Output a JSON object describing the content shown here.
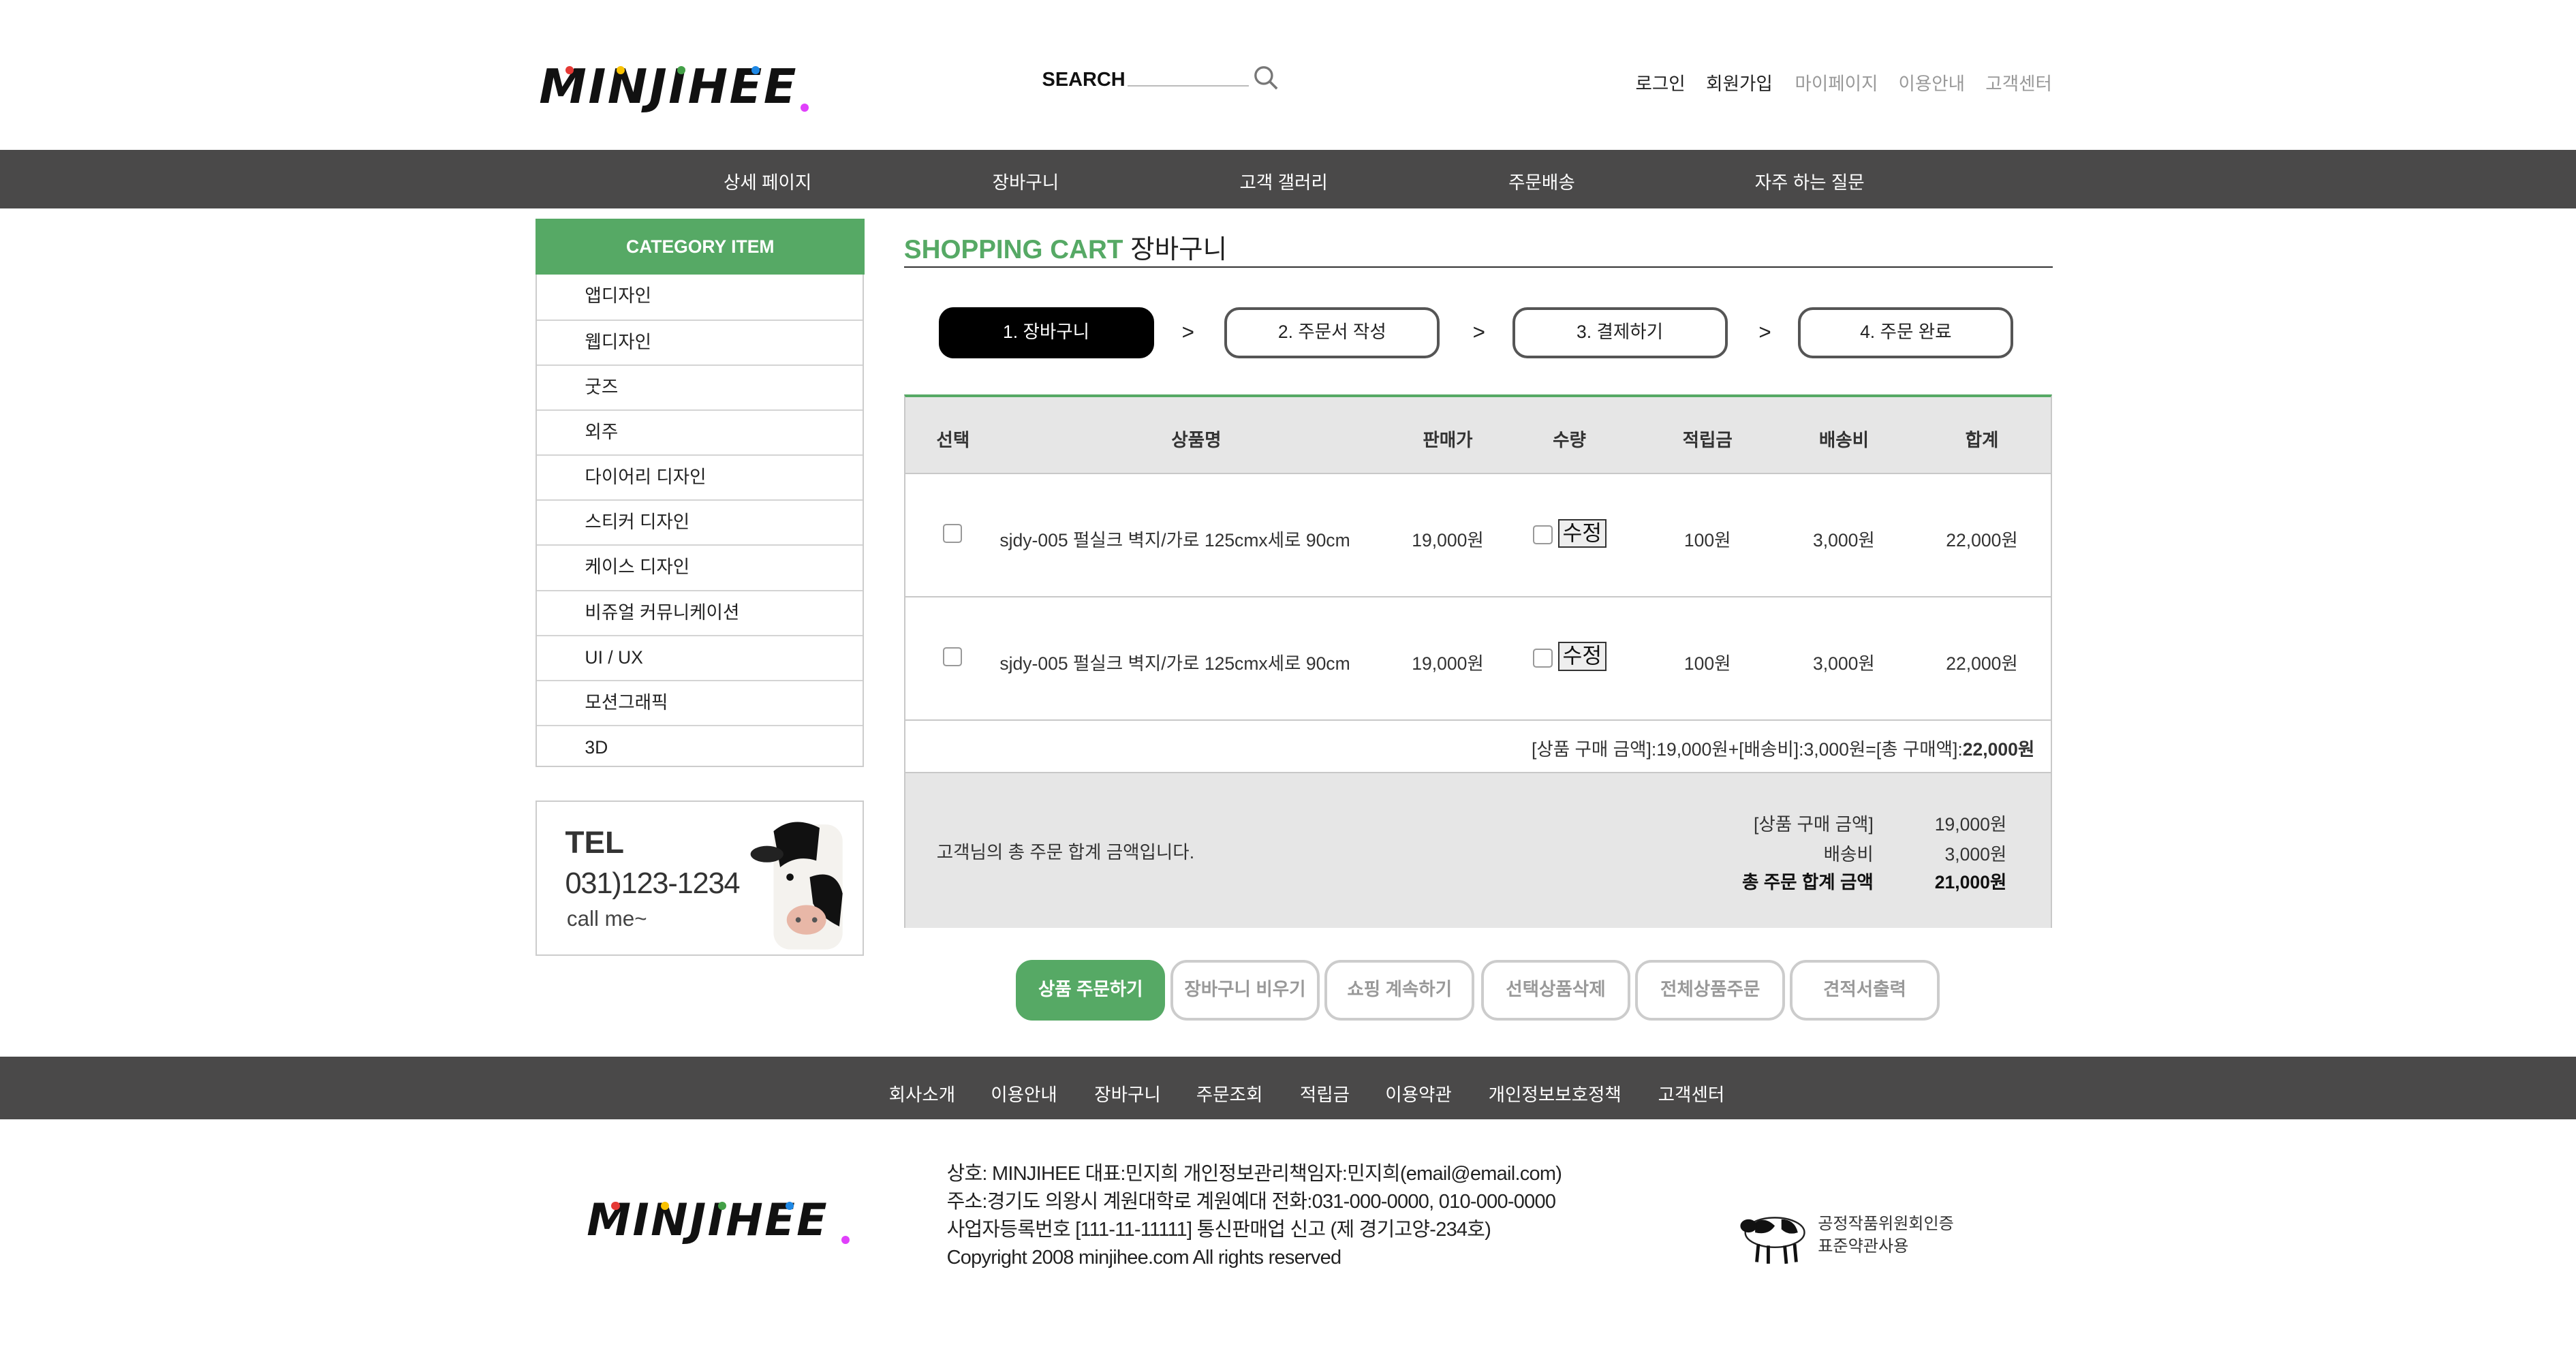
{
  "header": {
    "logo_text": "MINJIHEE",
    "search_label": "SEARCH",
    "top_links": [
      "로그인",
      "회원가입",
      "마이페이지",
      "이용안내",
      "고객센터"
    ]
  },
  "nav": [
    "상세 페이지",
    "장바구니",
    "고객 갤러리",
    "주문배송",
    "자주 하는 질문"
  ],
  "sidebar": {
    "category_title": "CATEGORY ITEM",
    "items": [
      "앱디자인",
      "웹디자인",
      "굿즈",
      "외주",
      "다이어리 디자인",
      "스티커 디자인",
      "케이스 디자인",
      "비쥬얼 커뮤니케이션",
      "UI / UX",
      "모션그래픽",
      "3D"
    ],
    "tel_label": "TEL",
    "tel_number": "031)123-1234",
    "tel_note": "call me~"
  },
  "cart": {
    "title_en": "SHOPPING CART",
    "title_ko": "장바구니",
    "steps": [
      "1. 장바구니",
      "2. 주문서 작성",
      "3. 결제하기",
      "4. 주문 완료"
    ],
    "step_arrow": ">",
    "columns": [
      "선택",
      "상품명",
      "판매가",
      "수량",
      "적립금",
      "배송비",
      "합계"
    ],
    "edit_label": "수정",
    "rows": [
      {
        "name": "sjdy-005 펄실크 벽지/가로 125cmx세로 90cm",
        "price": "19,000원",
        "points": "100원",
        "shipping": "3,000원",
        "total": "22,000원"
      },
      {
        "name": "sjdy-005 펄실크 벽지/가로 125cmx세로 90cm",
        "price": "19,000원",
        "points": "100원",
        "shipping": "3,000원",
        "total": "22,000원"
      }
    ],
    "subtotal_line": "[상품 구매 금액]:19,000원+[배송비]:3,000원=[총 구매액]:",
    "subtotal_total": "22,000원",
    "summary_label": "고객님의 총 주문 합계 금액입니다.",
    "summary": [
      {
        "label": "[상품 구매 금액]",
        "value": "19,000원"
      },
      {
        "label": "배송비",
        "value": "3,000원"
      },
      {
        "label": "총 주문 합계 금액",
        "value": "21,000원"
      }
    ]
  },
  "buttons": [
    "상품 주문하기",
    "장바구니 비우기",
    "쇼핑 계속하기",
    "선택상품삭제",
    "전체상품주문",
    "견적서출력"
  ],
  "footer": {
    "nav": [
      "회사소개",
      "이용안내",
      "장바구니",
      "주문조회",
      "적립금",
      "이용약관",
      "개인정보보호정책",
      "고객센터"
    ],
    "info": [
      "상호: MINJIHEE 대표:민지희 개인정보관리책임자:민지희(email@email.com)",
      "주소:경기도 의왕시 계원대학로 계원예대 전화:031-000-0000, 010-000-0000",
      "사업자등록번호 [111-11-11111] 통신판매업 신고 (제 경기고양-234호)",
      "Copyright 2008 minjihee.com All rights reserved"
    ],
    "cert_lines": [
      "공정작품위원회인증",
      "표준약관사용"
    ]
  },
  "colors": {
    "accent": "#56a965",
    "nav_bg": "#4a4949"
  }
}
